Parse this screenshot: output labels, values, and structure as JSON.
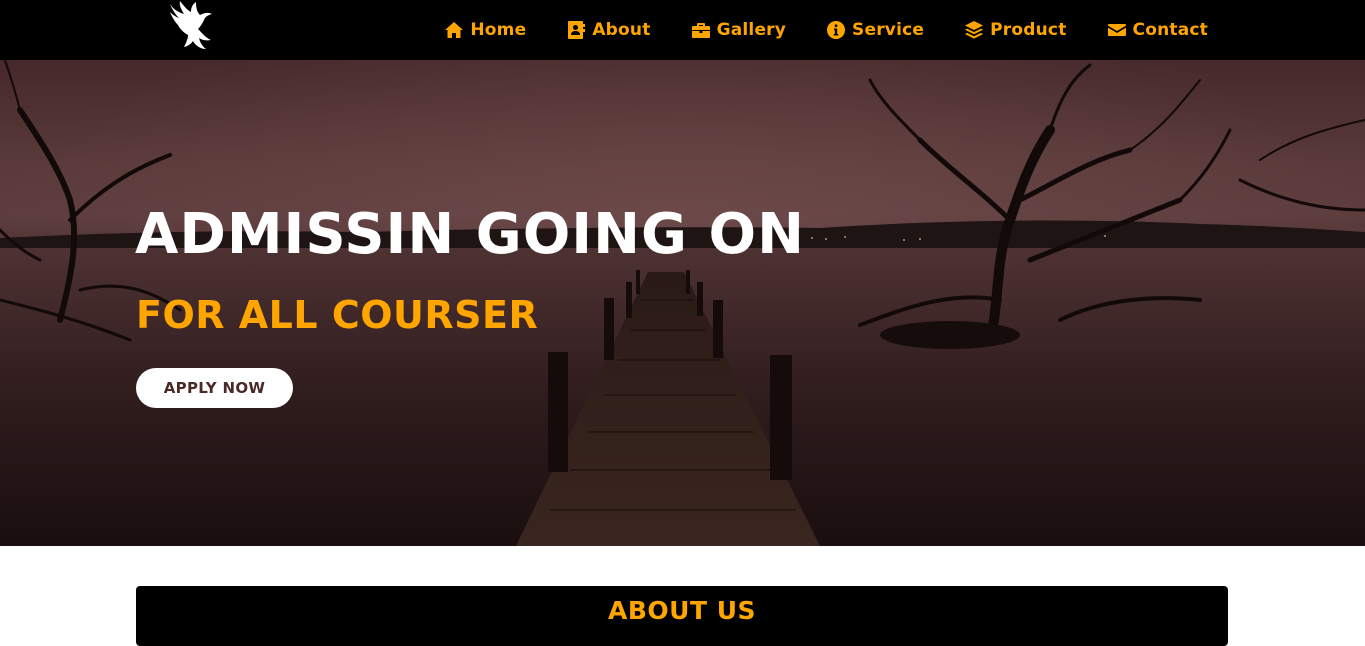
{
  "brand": {
    "logo_icon": "eagle-icon"
  },
  "nav": {
    "items": [
      {
        "label": "Home",
        "icon": "home-icon"
      },
      {
        "label": "About",
        "icon": "contact-card-icon"
      },
      {
        "label": "Gallery",
        "icon": "briefcase-icon"
      },
      {
        "label": "Service",
        "icon": "info-circle-icon"
      },
      {
        "label": "Product",
        "icon": "layers-icon"
      },
      {
        "label": "Contact",
        "icon": "envelope-icon"
      }
    ]
  },
  "hero": {
    "title": "ADMISSIN GOING ON",
    "subtitle": "FOR ALL COURSER",
    "button_label": "APPLY NOW",
    "background": "lake-pier-night-image"
  },
  "about": {
    "title": "ABOUT US"
  },
  "colors": {
    "accent": "#ffa500",
    "nav_bg": "#000000",
    "text_light": "#ffffff"
  }
}
